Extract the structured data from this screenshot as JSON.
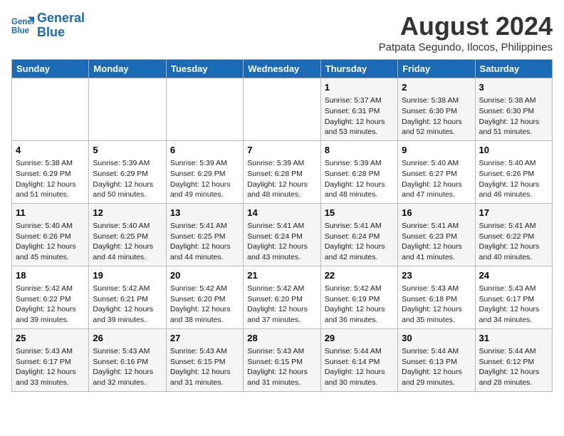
{
  "header": {
    "logo_line1": "General",
    "logo_line2": "Blue",
    "month_year": "August 2024",
    "location": "Patpata Segundo, Ilocos, Philippines"
  },
  "weekdays": [
    "Sunday",
    "Monday",
    "Tuesday",
    "Wednesday",
    "Thursday",
    "Friday",
    "Saturday"
  ],
  "weeks": [
    [
      {
        "day": "",
        "info": ""
      },
      {
        "day": "",
        "info": ""
      },
      {
        "day": "",
        "info": ""
      },
      {
        "day": "",
        "info": ""
      },
      {
        "day": "1",
        "info": "Sunrise: 5:37 AM\nSunset: 6:31 PM\nDaylight: 12 hours\nand 53 minutes."
      },
      {
        "day": "2",
        "info": "Sunrise: 5:38 AM\nSunset: 6:30 PM\nDaylight: 12 hours\nand 52 minutes."
      },
      {
        "day": "3",
        "info": "Sunrise: 5:38 AM\nSunset: 6:30 PM\nDaylight: 12 hours\nand 51 minutes."
      }
    ],
    [
      {
        "day": "4",
        "info": "Sunrise: 5:38 AM\nSunset: 6:29 PM\nDaylight: 12 hours\nand 51 minutes."
      },
      {
        "day": "5",
        "info": "Sunrise: 5:39 AM\nSunset: 6:29 PM\nDaylight: 12 hours\nand 50 minutes."
      },
      {
        "day": "6",
        "info": "Sunrise: 5:39 AM\nSunset: 6:29 PM\nDaylight: 12 hours\nand 49 minutes."
      },
      {
        "day": "7",
        "info": "Sunrise: 5:39 AM\nSunset: 6:28 PM\nDaylight: 12 hours\nand 48 minutes."
      },
      {
        "day": "8",
        "info": "Sunrise: 5:39 AM\nSunset: 6:28 PM\nDaylight: 12 hours\nand 48 minutes."
      },
      {
        "day": "9",
        "info": "Sunrise: 5:40 AM\nSunset: 6:27 PM\nDaylight: 12 hours\nand 47 minutes."
      },
      {
        "day": "10",
        "info": "Sunrise: 5:40 AM\nSunset: 6:26 PM\nDaylight: 12 hours\nand 46 minutes."
      }
    ],
    [
      {
        "day": "11",
        "info": "Sunrise: 5:40 AM\nSunset: 6:26 PM\nDaylight: 12 hours\nand 45 minutes."
      },
      {
        "day": "12",
        "info": "Sunrise: 5:40 AM\nSunset: 6:25 PM\nDaylight: 12 hours\nand 44 minutes."
      },
      {
        "day": "13",
        "info": "Sunrise: 5:41 AM\nSunset: 6:25 PM\nDaylight: 12 hours\nand 44 minutes."
      },
      {
        "day": "14",
        "info": "Sunrise: 5:41 AM\nSunset: 6:24 PM\nDaylight: 12 hours\nand 43 minutes."
      },
      {
        "day": "15",
        "info": "Sunrise: 5:41 AM\nSunset: 6:24 PM\nDaylight: 12 hours\nand 42 minutes."
      },
      {
        "day": "16",
        "info": "Sunrise: 5:41 AM\nSunset: 6:23 PM\nDaylight: 12 hours\nand 41 minutes."
      },
      {
        "day": "17",
        "info": "Sunrise: 5:41 AM\nSunset: 6:22 PM\nDaylight: 12 hours\nand 40 minutes."
      }
    ],
    [
      {
        "day": "18",
        "info": "Sunrise: 5:42 AM\nSunset: 6:22 PM\nDaylight: 12 hours\nand 39 minutes."
      },
      {
        "day": "19",
        "info": "Sunrise: 5:42 AM\nSunset: 6:21 PM\nDaylight: 12 hours\nand 39 minutes."
      },
      {
        "day": "20",
        "info": "Sunrise: 5:42 AM\nSunset: 6:20 PM\nDaylight: 12 hours\nand 38 minutes."
      },
      {
        "day": "21",
        "info": "Sunrise: 5:42 AM\nSunset: 6:20 PM\nDaylight: 12 hours\nand 37 minutes."
      },
      {
        "day": "22",
        "info": "Sunrise: 5:42 AM\nSunset: 6:19 PM\nDaylight: 12 hours\nand 36 minutes."
      },
      {
        "day": "23",
        "info": "Sunrise: 5:43 AM\nSunset: 6:18 PM\nDaylight: 12 hours\nand 35 minutes."
      },
      {
        "day": "24",
        "info": "Sunrise: 5:43 AM\nSunset: 6:17 PM\nDaylight: 12 hours\nand 34 minutes."
      }
    ],
    [
      {
        "day": "25",
        "info": "Sunrise: 5:43 AM\nSunset: 6:17 PM\nDaylight: 12 hours\nand 33 minutes."
      },
      {
        "day": "26",
        "info": "Sunrise: 5:43 AM\nSunset: 6:16 PM\nDaylight: 12 hours\nand 32 minutes."
      },
      {
        "day": "27",
        "info": "Sunrise: 5:43 AM\nSunset: 6:15 PM\nDaylight: 12 hours\nand 31 minutes."
      },
      {
        "day": "28",
        "info": "Sunrise: 5:43 AM\nSunset: 6:15 PM\nDaylight: 12 hours\nand 31 minutes."
      },
      {
        "day": "29",
        "info": "Sunrise: 5:44 AM\nSunset: 6:14 PM\nDaylight: 12 hours\nand 30 minutes."
      },
      {
        "day": "30",
        "info": "Sunrise: 5:44 AM\nSunset: 6:13 PM\nDaylight: 12 hours\nand 29 minutes."
      },
      {
        "day": "31",
        "info": "Sunrise: 5:44 AM\nSunset: 6:12 PM\nDaylight: 12 hours\nand 28 minutes."
      }
    ]
  ]
}
